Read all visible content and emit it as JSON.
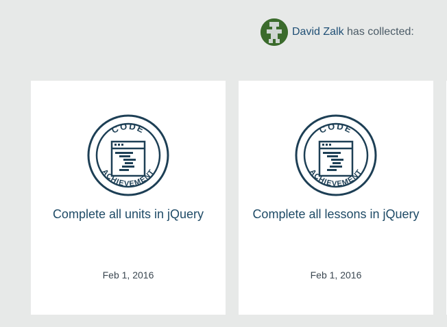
{
  "profile": {
    "user_name": "David Zalk",
    "collected_suffix": "has collected:"
  },
  "badge": {
    "top_text": "CODE",
    "bottom_text": "ACHIEVEMENT",
    "color": "#1d3f55"
  },
  "achievements": [
    {
      "title": "Complete all units in jQuery",
      "date": "Feb 1, 2016"
    },
    {
      "title": "Complete all lessons in jQuery",
      "date": "Feb 1, 2016"
    }
  ]
}
